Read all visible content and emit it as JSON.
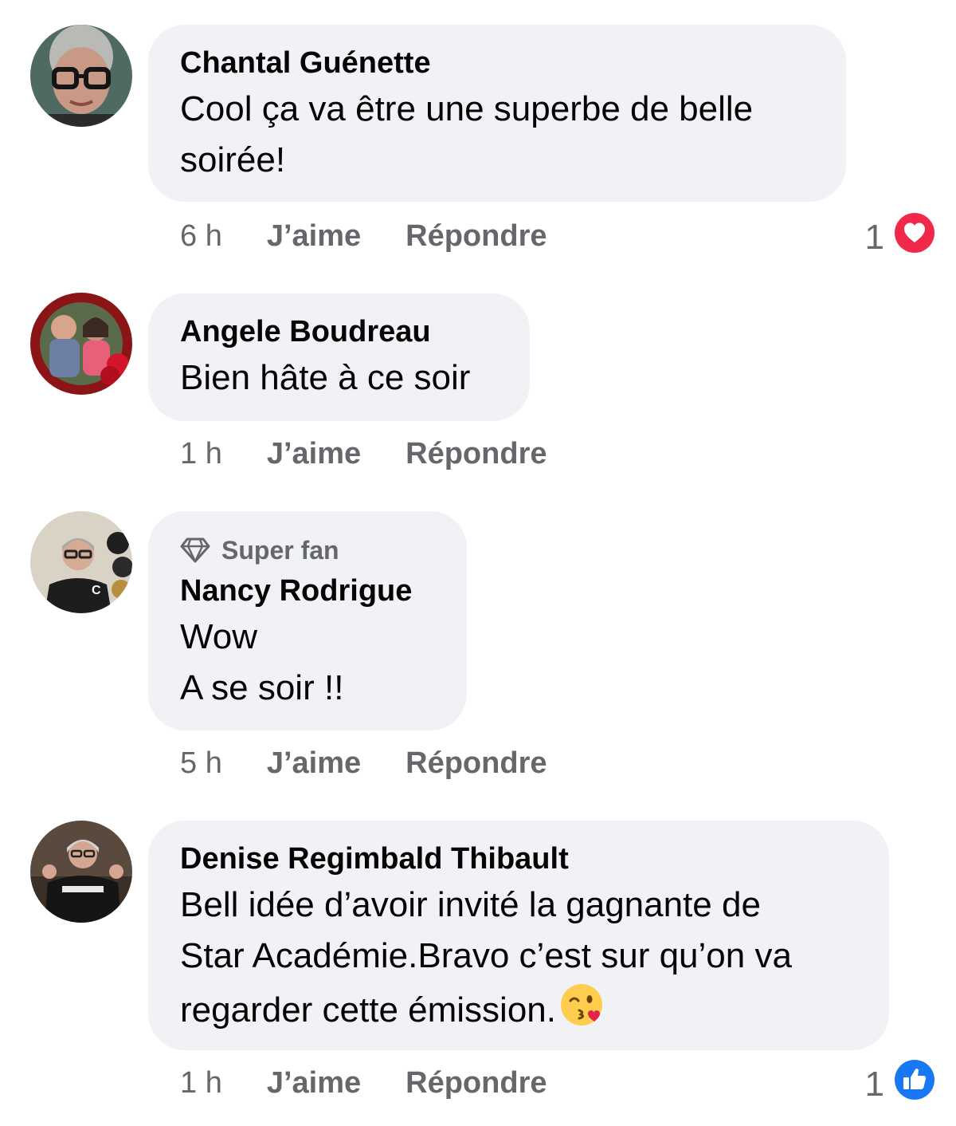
{
  "comments": [
    {
      "author": "Chantal Guénette",
      "lines": [
        "Cool ça va être une superbe de belle",
        "soirée!"
      ],
      "time": "6 h",
      "like_label": "J’aime",
      "reply_label": "Répondre",
      "reaction_count": "1",
      "reaction_icon": "love-reaction-icon"
    },
    {
      "author": "Angele Boudreau",
      "lines": [
        "Bien hâte à ce soir"
      ],
      "time": "1 h",
      "like_label": "J’aime",
      "reply_label": "Répondre"
    },
    {
      "badge": "Super fan",
      "author": "Nancy Rodrigue",
      "lines": [
        "Wow",
        "A se soir !!"
      ],
      "time": "5 h",
      "like_label": "J’aime",
      "reply_label": "Répondre"
    },
    {
      "author": "Denise Regimbald Thibault",
      "lines": [
        "Bell idée d’avoir invité la gagnante de",
        "Star Académie.Bravo c’est sur qu’on va",
        "regarder cette émission."
      ],
      "emoji": "kiss-wink-emoji",
      "time": "1 h",
      "like_label": "J’aime",
      "reply_label": "Répondre",
      "reaction_count": "1",
      "reaction_icon": "like-reaction-icon"
    }
  ],
  "colors": {
    "bubble": "#f0f2f5",
    "secondary_text": "#65676b",
    "love": "#f02849",
    "like": "#1877f2"
  }
}
